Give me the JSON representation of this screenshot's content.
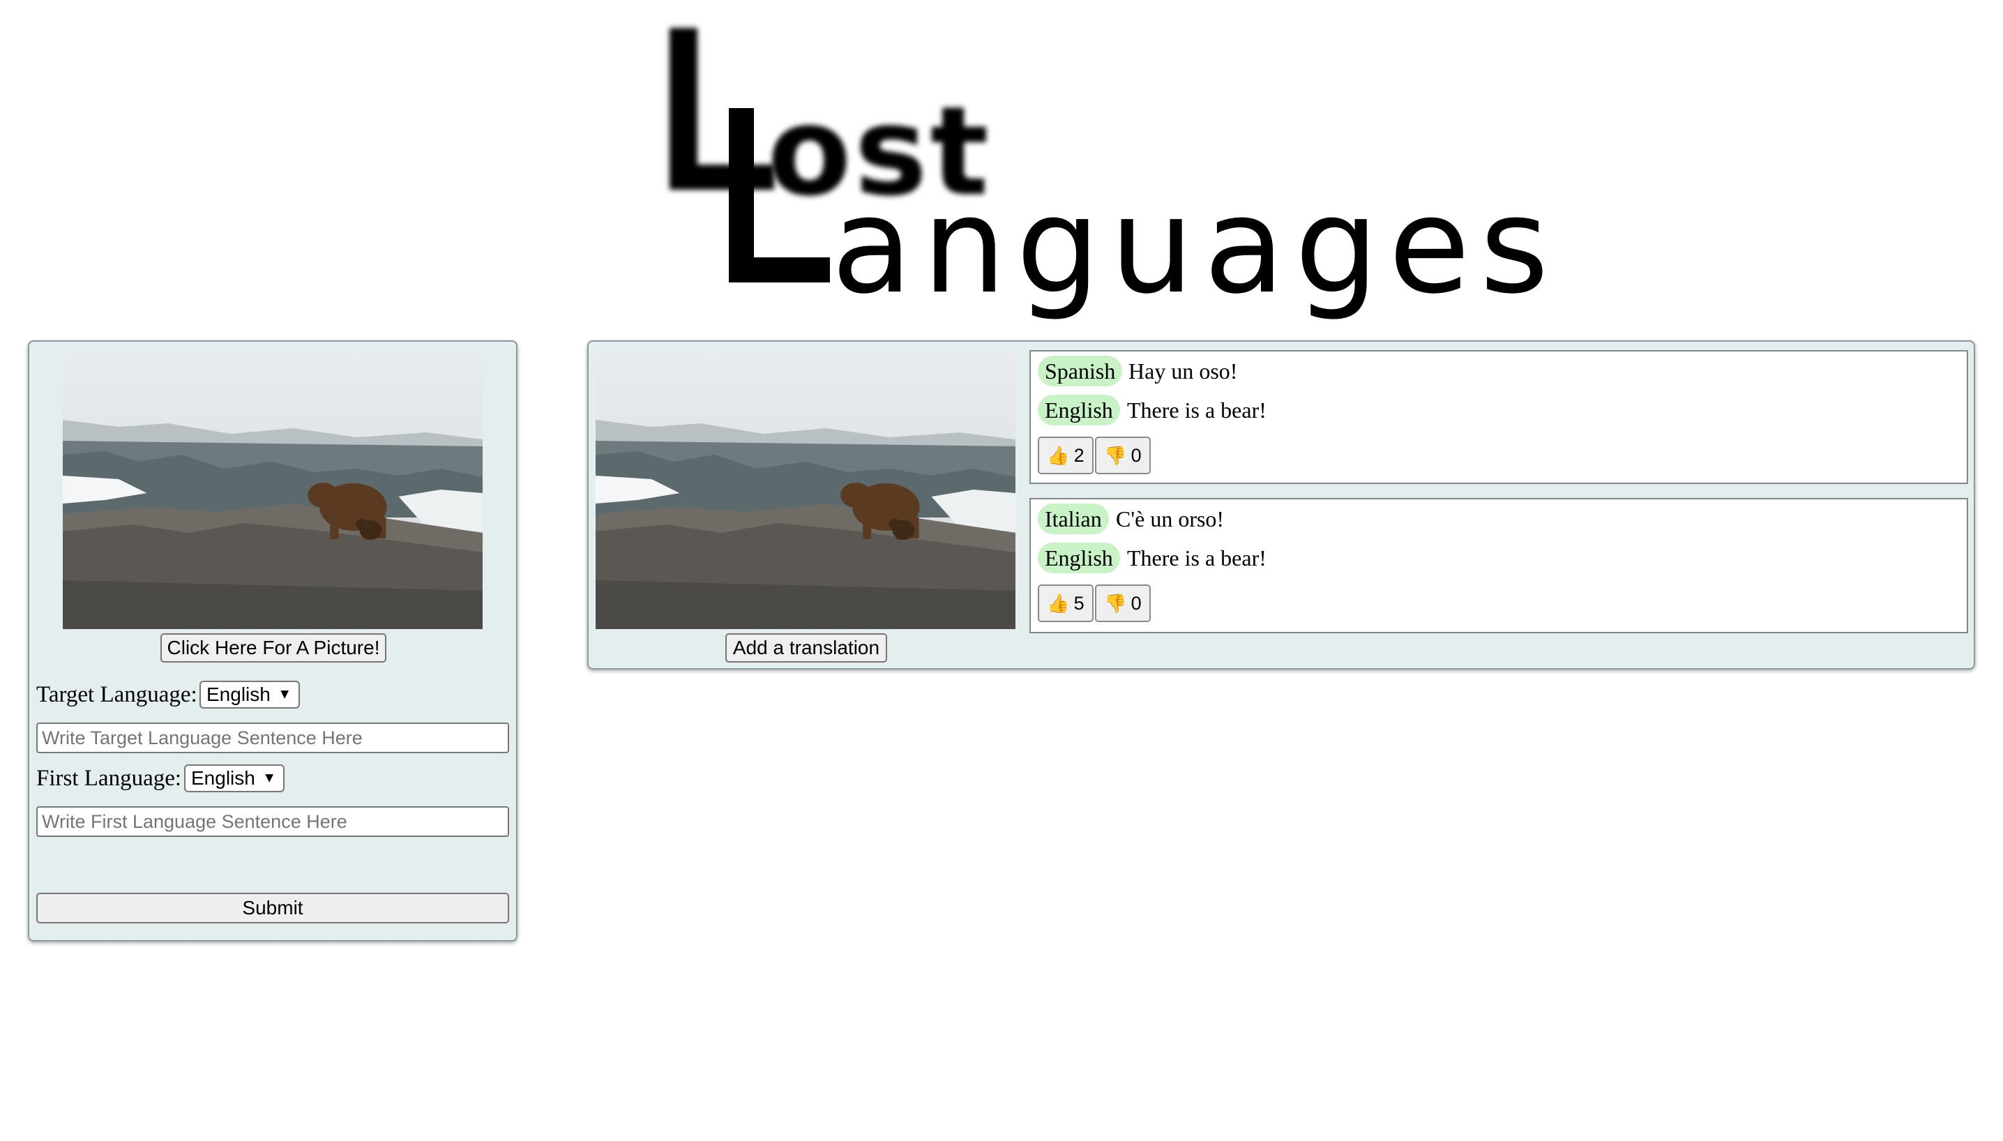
{
  "logo": {
    "word_top": "ost",
    "word_bottom": "anguages",
    "initial": "L"
  },
  "left_panel": {
    "picture_button": "Click Here For A Picture!",
    "target_language_label": "Target Language:",
    "target_language_selected": "English",
    "target_sentence_placeholder": "Write Target Language Sentence Here",
    "first_language_label": "First Language:",
    "first_language_selected": "English",
    "first_sentence_placeholder": "Write First Language Sentence Here",
    "submit_label": "Submit"
  },
  "right_panel": {
    "add_translation_label": "Add a translation",
    "translations": [
      {
        "language": "Spanish",
        "sentence": "Hay un oso!",
        "english_label": "English",
        "english_sentence": "There is a bear!",
        "likes": "2",
        "dislikes": "0"
      },
      {
        "language": "Italian",
        "sentence": "C'è un orso!",
        "english_label": "English",
        "english_sentence": "There is a bear!",
        "likes": "5",
        "dislikes": "0"
      }
    ]
  },
  "icons": {
    "thumbs_up": "👍",
    "thumbs_down": "👎",
    "chevron": "⌄"
  },
  "colors": {
    "panel_bg": "#e5eeee",
    "tag_bg": "#c9f2c7"
  }
}
